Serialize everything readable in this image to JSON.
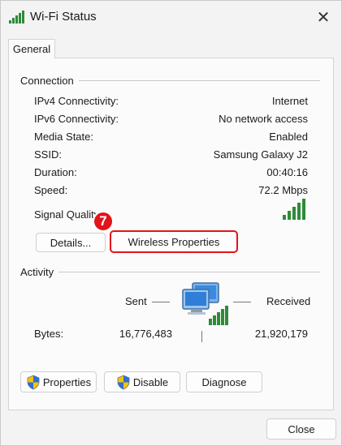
{
  "window": {
    "title": "Wi-Fi Status",
    "close_glyph": "✕"
  },
  "tabs": [
    {
      "label": "General"
    }
  ],
  "connection": {
    "label": "Connection",
    "rows": [
      {
        "label": "IPv4 Connectivity:",
        "value": "Internet"
      },
      {
        "label": "IPv6 Connectivity:",
        "value": "No network access"
      },
      {
        "label": "Media State:",
        "value": "Enabled"
      },
      {
        "label": "SSID:",
        "value": "Samsung Galaxy J2"
      },
      {
        "label": "Duration:",
        "value": "00:40:16"
      },
      {
        "label": "Speed:",
        "value": "72.2 Mbps"
      }
    ],
    "signal_label": "Signal Quality",
    "signal_bars": 5,
    "signal_bars_total": 5
  },
  "buttons": {
    "details": "Details...",
    "wireless_properties": "Wireless Properties",
    "properties": "Properties",
    "disable": "Disable",
    "diagnose": "Diagnose",
    "close": "Close"
  },
  "annotation": {
    "step": "7",
    "color": "#e3131b"
  },
  "activity": {
    "label": "Activity",
    "sent_label": "Sent",
    "received_label": "Received",
    "bytes_label": "Bytes:",
    "bytes_sent": "16,776,483",
    "bytes_received": "21,920,179"
  },
  "colors": {
    "signal_green": "#2e8b3a",
    "accent_red": "#e3131b"
  },
  "icons": {
    "title": "wifi-signal-icon",
    "activity": "network-computers-icon",
    "uac": "uac-shield-icon"
  }
}
